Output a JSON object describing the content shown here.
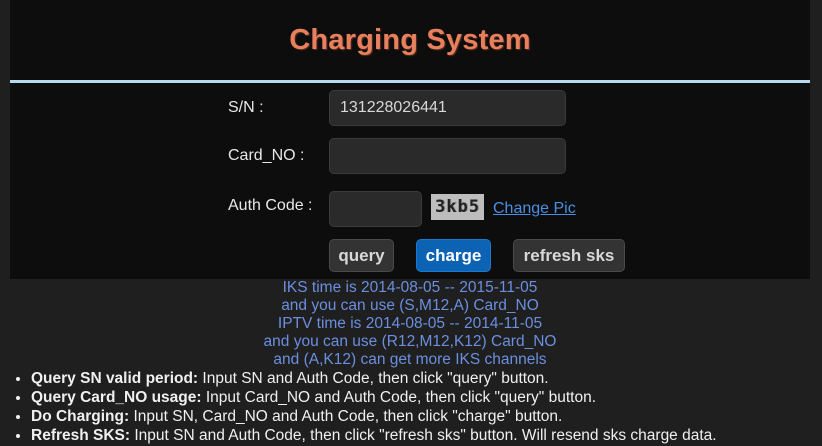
{
  "header": {
    "title": "Charging System"
  },
  "form": {
    "sn_label": "S/N :",
    "sn_value": "131228026441",
    "card_label": "Card_NO :",
    "card_value": "",
    "auth_label": "Auth Code :",
    "auth_value": "",
    "captcha_text": "3kb5",
    "change_pic": "Change Pic"
  },
  "buttons": {
    "query": "query",
    "charge": "charge",
    "refresh": "refresh sks"
  },
  "info": [
    "IKS time is 2014-08-05 -- 2015-11-05",
    "and you can use (S,M12,A) Card_NO",
    "IPTV time is 2014-08-05 -- 2014-11-05",
    "and you can use (R12,M12,K12) Card_NO",
    "and (A,K12) can get more IKS channels"
  ],
  "help": [
    {
      "title": "Query SN valid period:",
      "text": " Input SN and Auth Code, then click \"query\" button."
    },
    {
      "title": "Query Card_NO usage:",
      "text": " Input Card_NO and Auth Code, then click \"query\" button."
    },
    {
      "title": "Do Charging:",
      "text": " Input SN, Card_NO and Auth Code, then click \"charge\" button."
    },
    {
      "title": "Refresh SKS:",
      "text": " Input SN and Auth Code, then click \"refresh sks\" button. Will resend sks charge data."
    }
  ]
}
